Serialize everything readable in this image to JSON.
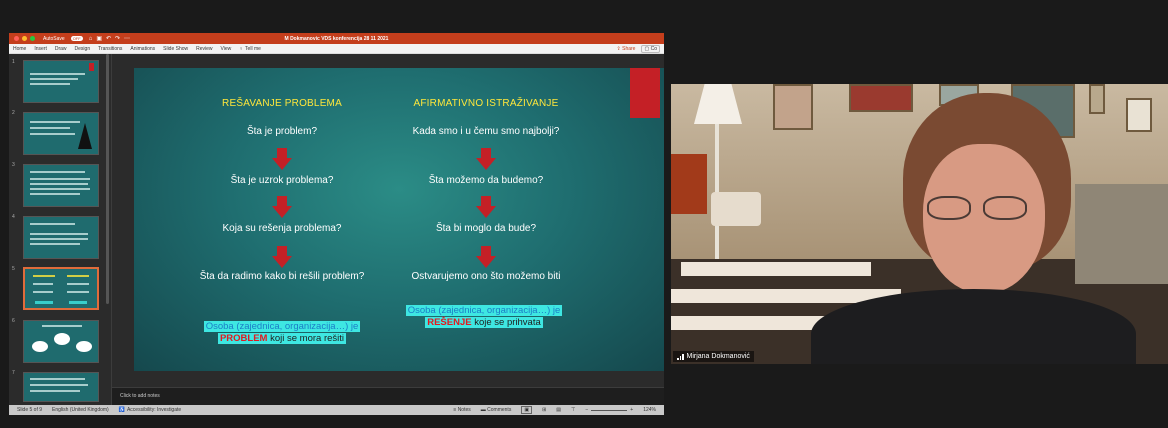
{
  "ppt": {
    "autosave": "AutoSave",
    "autosave_state": "OFF",
    "doc_title": "M Dokmanovic VDS konferencija 28 11 2021",
    "tabs": [
      "Home",
      "Insert",
      "Draw",
      "Design",
      "Transitions",
      "Animations",
      "Slide Show",
      "Review",
      "View"
    ],
    "tell_me": "Tell me",
    "share": "Share",
    "comments_short": "Co",
    "thumb_numbers": [
      "1",
      "2",
      "3",
      "4",
      "5",
      "6",
      "7"
    ],
    "notes_placeholder": "Click to add notes",
    "status": {
      "slide": "Slide 5 of 9",
      "language": "English (United Kingdom)",
      "accessibility": "Accessibility: Investigate",
      "notes": "Notes",
      "comments": "Comments",
      "zoom": "124%"
    }
  },
  "slide": {
    "left_head": "REŠAVANJE PROBLEMA",
    "right_head": "AFIRMATIVNO ISTRAŽIVANJE",
    "left_q": [
      "Šta je problem?",
      "Šta je uzrok problema?",
      "Koja su rešenja problema?",
      "Šta da radimo kako bi rešili problem?"
    ],
    "right_q": [
      "Kada smo i u čemu smo najbolji?",
      "Šta možemo da budemo?",
      "Šta bi moglo da bude?",
      "Ostvarujemo ono što možemo biti"
    ],
    "left_box_line1": "Osoba (zajednica, organizacija…) je",
    "left_box_bold": "PROBLEM",
    "left_box_rest": " koji se mora rešiti",
    "right_box_line1": "Osoba (zajednica, organizacija…) je",
    "right_box_bold": "REŠENJE",
    "right_box_rest": " koje se prihvata"
  },
  "video": {
    "participant": "Mirjana Dokmanović"
  },
  "colors": {
    "ppt_accent": "#c43e1c",
    "slide_bg": "#1f6e70",
    "heading_yellow": "#ffe73b",
    "arrow_red": "#c42026",
    "highlight_cyan": "#3ee7e2"
  }
}
